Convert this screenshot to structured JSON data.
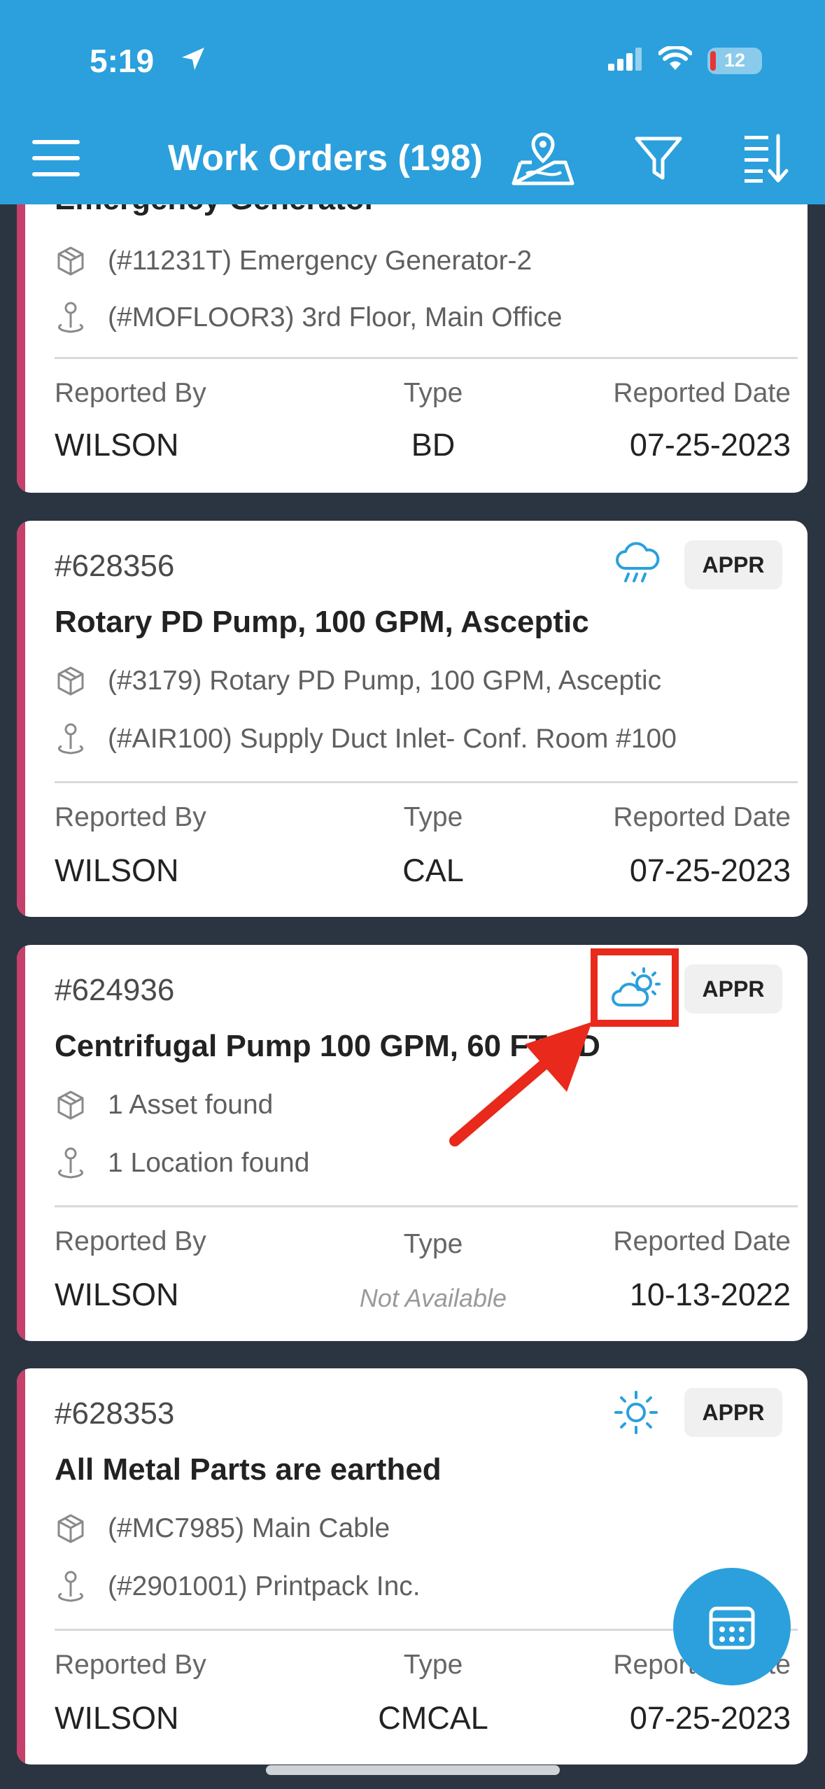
{
  "status_bar": {
    "time": "5:19",
    "battery": "12"
  },
  "header": {
    "title": "Work Orders (198)"
  },
  "cards": [
    {
      "title": "Emergency Generator",
      "asset": "(#11231T) Emergency Generator-2",
      "location": "(#MOFLOOR3) 3rd Floor, Main Office",
      "reported_by_label": "Reported By",
      "type_label": "Type",
      "date_label": "Reported Date",
      "reported_by": "WILSON",
      "type": "BD",
      "date": "07-25-2023"
    },
    {
      "number": "#628356",
      "weather_icon": "rain-cloud-icon",
      "status": "APPR",
      "title": "Rotary PD Pump, 100 GPM, Asceptic",
      "asset": "(#3179) Rotary PD Pump, 100 GPM, Asceptic",
      "location": "(#AIR100) Supply Duct Inlet- Conf. Room #100",
      "reported_by_label": "Reported By",
      "type_label": "Type",
      "date_label": "Reported Date",
      "reported_by": "WILSON",
      "type": "CAL",
      "date": "07-25-2023"
    },
    {
      "number": "#624936",
      "weather_icon": "partly-cloudy-icon",
      "status": "APPR",
      "title": "Centrifugal Pump 100 GPM, 60 FT HD",
      "asset": "1 Asset found",
      "location": "1 Location found",
      "reported_by_label": "Reported By",
      "type_label": "Type",
      "date_label": "Reported Date",
      "reported_by": "WILSON",
      "type": "Not Available",
      "date": "10-13-2022"
    },
    {
      "number": "#628353",
      "weather_icon": "sun-icon",
      "status": "APPR",
      "title": "All Metal Parts are earthed",
      "asset": "(#MC7985) Main Cable",
      "location": "(#2901001) Printpack Inc.",
      "reported_by_label": "Reported By",
      "type_label": "Type",
      "date_label": "Reported Date",
      "reported_by": "WILSON",
      "type": "CMCAL",
      "date": "07-25-2023"
    }
  ],
  "colors": {
    "header": "#2ba0dc",
    "accent_strip": "#c5406a",
    "highlight": "#e8291b",
    "icon_blue": "#2ba0dc"
  }
}
